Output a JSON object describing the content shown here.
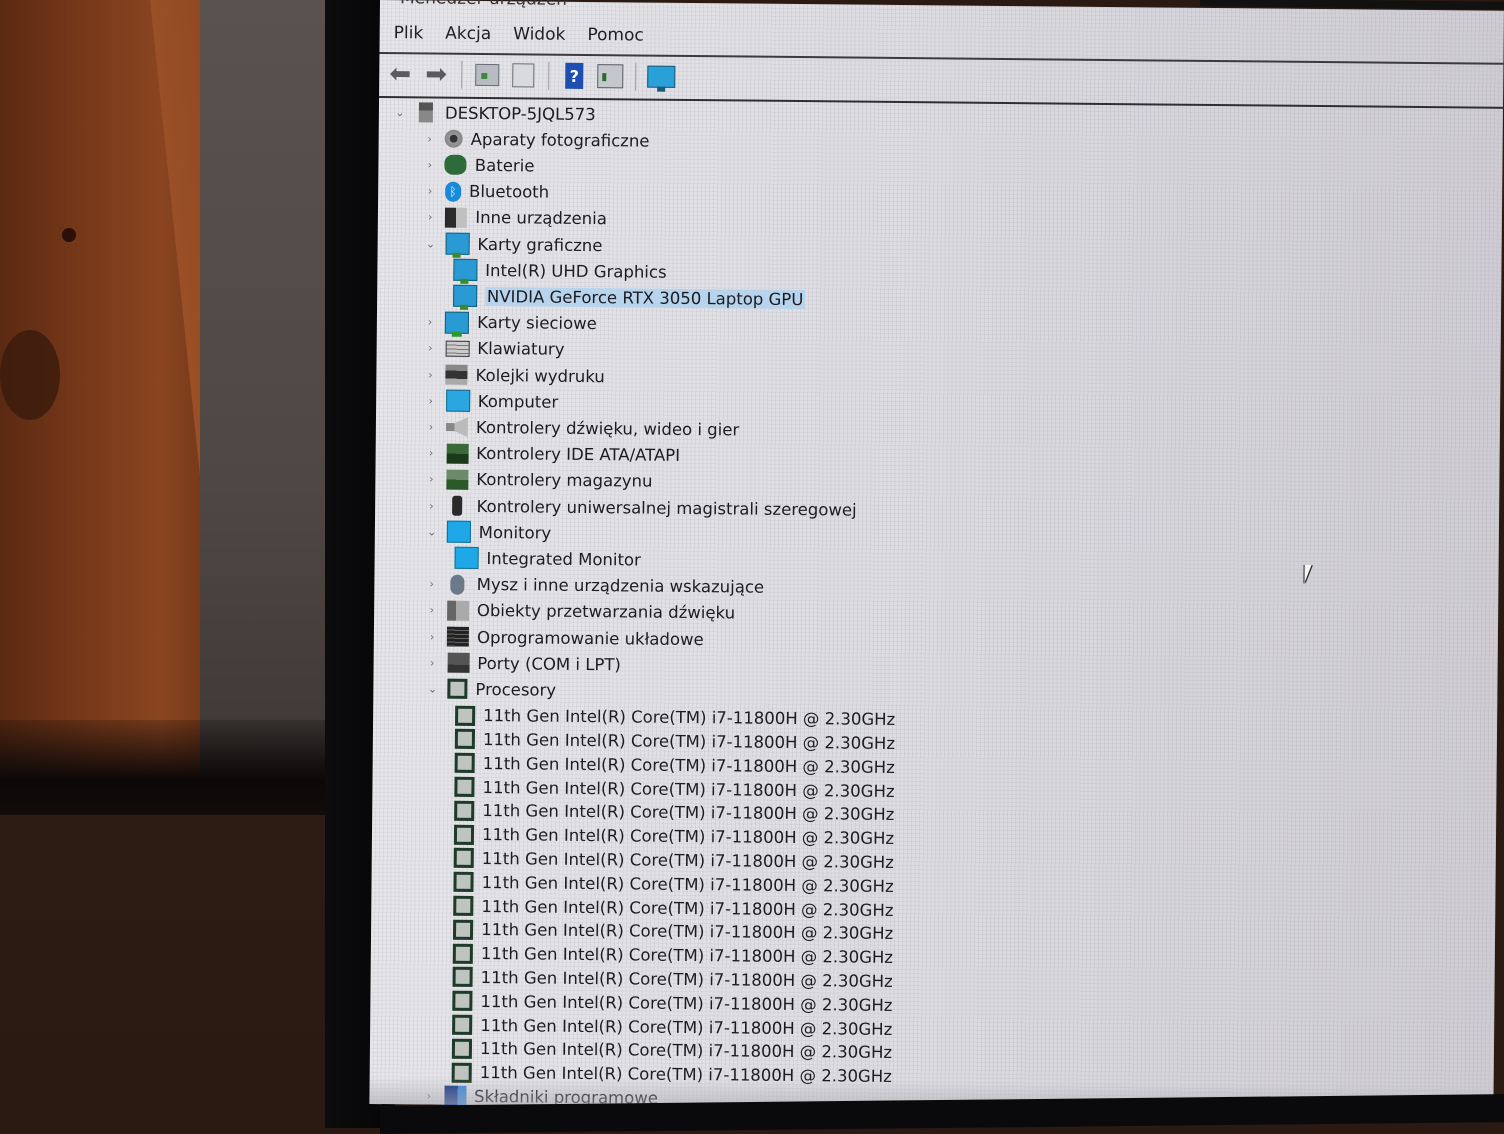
{
  "window": {
    "title": "Menedżer urządzeń"
  },
  "menubar": {
    "items": [
      {
        "label": "Plik"
      },
      {
        "label": "Akcja"
      },
      {
        "label": "Widok"
      },
      {
        "label": "Pomoc"
      }
    ]
  },
  "toolbar": {
    "buttons": [
      {
        "name": "back",
        "icon": "arrow-left-icon"
      },
      {
        "name": "forward",
        "icon": "arrow-right-icon"
      },
      {
        "name": "show-hide-console-tree",
        "icon": "console-tree-icon"
      },
      {
        "name": "properties",
        "icon": "properties-icon"
      },
      {
        "name": "help",
        "icon": "help-icon",
        "glyph": "?"
      },
      {
        "name": "view-action-pane",
        "icon": "action-pane-icon"
      },
      {
        "name": "scan-hardware",
        "icon": "monitor-scan-icon"
      }
    ]
  },
  "tree": {
    "root": {
      "label": "DESKTOP-5JQL573",
      "expanded": true
    },
    "categories": [
      {
        "label": "Aparaty fotograficzne",
        "icon": "camera-icon",
        "expanded": false
      },
      {
        "label": "Baterie",
        "icon": "battery-icon",
        "expanded": false
      },
      {
        "label": "Bluetooth",
        "icon": "bluetooth-icon",
        "expanded": false
      },
      {
        "label": "Inne urządzenia",
        "icon": "other-devices-icon",
        "expanded": false
      },
      {
        "label": "Karty graficzne",
        "icon": "display-adapter-icon",
        "expanded": true,
        "children": [
          {
            "label": "Intel(R) UHD Graphics",
            "selected": false
          },
          {
            "label": "NVIDIA GeForce RTX 3050 Laptop GPU",
            "selected": true
          }
        ]
      },
      {
        "label": "Karty sieciowe",
        "icon": "network-adapter-icon",
        "expanded": false
      },
      {
        "label": "Klawiatury",
        "icon": "keyboard-icon",
        "expanded": false
      },
      {
        "label": "Kolejki wydruku",
        "icon": "printer-icon",
        "expanded": false
      },
      {
        "label": "Komputer",
        "icon": "computer-icon",
        "expanded": false
      },
      {
        "label": "Kontrolery dźwięku, wideo i gier",
        "icon": "speaker-icon",
        "expanded": false
      },
      {
        "label": "Kontrolery IDE ATA/ATAPI",
        "icon": "ide-controller-icon",
        "expanded": false
      },
      {
        "label": "Kontrolery magazynu",
        "icon": "storage-controller-icon",
        "expanded": false
      },
      {
        "label": "Kontrolery uniwersalnej magistrali szeregowej",
        "icon": "usb-icon",
        "expanded": false
      },
      {
        "label": "Monitory",
        "icon": "monitor-icon",
        "expanded": true,
        "children": [
          {
            "label": "Integrated Monitor",
            "selected": false
          }
        ]
      },
      {
        "label": "Mysz i inne urządzenia wskazujące",
        "icon": "mouse-icon",
        "expanded": false
      },
      {
        "label": "Obiekty przetwarzania dźwięku",
        "icon": "audio-processing-icon",
        "expanded": false
      },
      {
        "label": "Oprogramowanie układowe",
        "icon": "firmware-icon",
        "expanded": false
      },
      {
        "label": "Porty (COM i LPT)",
        "icon": "ports-icon",
        "expanded": false
      },
      {
        "label": "Procesory",
        "icon": "processor-icon",
        "expanded": true,
        "children": [
          {
            "label": "11th Gen Intel(R) Core(TM) i7-11800H @ 2.30GHz"
          },
          {
            "label": "11th Gen Intel(R) Core(TM) i7-11800H @ 2.30GHz"
          },
          {
            "label": "11th Gen Intel(R) Core(TM) i7-11800H @ 2.30GHz"
          },
          {
            "label": "11th Gen Intel(R) Core(TM) i7-11800H @ 2.30GHz"
          },
          {
            "label": "11th Gen Intel(R) Core(TM) i7-11800H @ 2.30GHz"
          },
          {
            "label": "11th Gen Intel(R) Core(TM) i7-11800H @ 2.30GHz"
          },
          {
            "label": "11th Gen Intel(R) Core(TM) i7-11800H @ 2.30GHz"
          },
          {
            "label": "11th Gen Intel(R) Core(TM) i7-11800H @ 2.30GHz"
          },
          {
            "label": "11th Gen Intel(R) Core(TM) i7-11800H @ 2.30GHz"
          },
          {
            "label": "11th Gen Intel(R) Core(TM) i7-11800H @ 2.30GHz"
          },
          {
            "label": "11th Gen Intel(R) Core(TM) i7-11800H @ 2.30GHz"
          },
          {
            "label": "11th Gen Intel(R) Core(TM) i7-11800H @ 2.30GHz"
          },
          {
            "label": "11th Gen Intel(R) Core(TM) i7-11800H @ 2.30GHz"
          },
          {
            "label": "11th Gen Intel(R) Core(TM) i7-11800H @ 2.30GHz"
          },
          {
            "label": "11th Gen Intel(R) Core(TM) i7-11800H @ 2.30GHz"
          },
          {
            "label": "11th Gen Intel(R) Core(TM) i7-11800H @ 2.30GHz"
          }
        ]
      },
      {
        "label": "Składniki programowe",
        "icon": "software-components-icon",
        "expanded": false
      }
    ]
  },
  "glyphs": {
    "chevron_right": "›",
    "chevron_down": "⌄",
    "bluetooth": "ᛒ",
    "arrow_left": "⬅",
    "arrow_right": "➡"
  },
  "colors": {
    "selection": "#b8d4ec",
    "window_bg": "#dedee3",
    "text": "#1c1c22"
  }
}
